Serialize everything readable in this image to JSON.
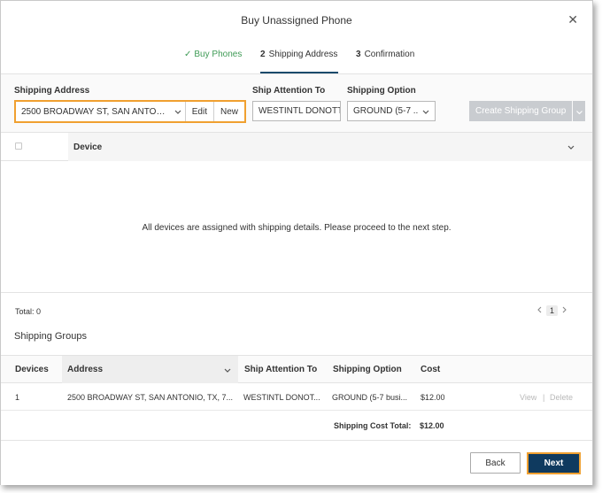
{
  "dialog": {
    "title": "Buy Unassigned Phone",
    "close_glyph": "✕"
  },
  "steps": [
    {
      "label": "Buy Phones",
      "state": "done"
    },
    {
      "num": "2",
      "label": "Shipping Address",
      "state": "active"
    },
    {
      "num": "3",
      "label": "Confirmation",
      "state": "pending"
    }
  ],
  "step_check": "✓",
  "toolbar": {
    "shipping_address_label": "Shipping Address",
    "shipping_address_value": "2500 BROADWAY ST, SAN ANTONIO, ...",
    "edit_label": "Edit",
    "new_label": "New",
    "ship_attention_label": "Ship Attention To",
    "ship_attention_value": "WESTINTL DONOTT",
    "shipping_option_label": "Shipping Option",
    "shipping_option_value": "GROUND (5-7 ...",
    "create_group_label": "Create Shipping Group"
  },
  "devices": {
    "column_device": "Device",
    "empty_message": "All devices are assigned with shipping details. Please proceed to the next step.",
    "total": "Total: 0",
    "page": "1"
  },
  "groups": {
    "title": "Shipping Groups",
    "headers": {
      "devices": "Devices",
      "address": "Address",
      "attention": "Ship Attention To",
      "option": "Shipping Option",
      "cost": "Cost"
    },
    "rows": [
      {
        "devices": "1",
        "address": "2500 BROADWAY ST, SAN ANTONIO, TX, 7...",
        "attention": "WESTINTL DONOT...",
        "option": "GROUND (5-7 busi...",
        "cost": "$12.00",
        "view": "View",
        "delete": "Delete"
      }
    ],
    "total_label": "Shipping Cost Total:",
    "total_value": "$12.00"
  },
  "footer": {
    "back_label": "Back",
    "next_label": "Next"
  },
  "colors": {
    "accent": "#f0a030",
    "primary": "#0f3a5f",
    "success": "#3f9b56",
    "disabled": "#c9ccd0"
  }
}
